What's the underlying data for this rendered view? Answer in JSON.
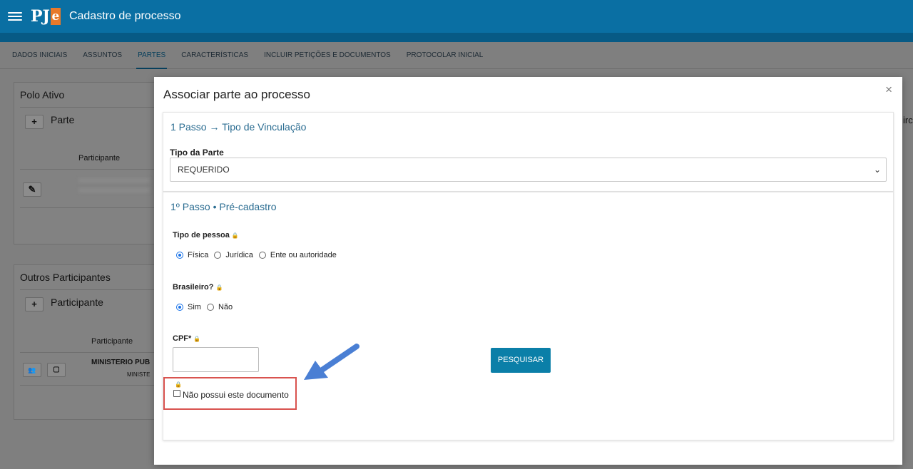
{
  "header": {
    "title": "Cadastro de processo",
    "logo_main": "PJ",
    "logo_accent": "e"
  },
  "tabs": [
    {
      "label": "DADOS INICIAIS"
    },
    {
      "label": "ASSUNTOS"
    },
    {
      "label": "PARTES",
      "active": true
    },
    {
      "label": "CARACTERÍSTICAS"
    },
    {
      "label": "INCLUIR PETIÇÕES E DOCUMENTOS"
    },
    {
      "label": "PROTOCOLAR INICIAL"
    }
  ],
  "background": {
    "polo_ativo": {
      "title": "Polo Ativo",
      "add_label": "Parte",
      "col_participante": "Participante"
    },
    "outros": {
      "title": "Outros Participantes",
      "add_label": "Participante",
      "col_participante": "Participante",
      "row_name": "MINISTERIO PUB",
      "row_sub": "MINISTE"
    },
    "right_edge_text": "irc"
  },
  "modal": {
    "title": "Associar parte ao processo",
    "close": "×",
    "step1": {
      "title": "1 Passo → Tipo de Vinculação",
      "field_label": "Tipo da Parte",
      "select_value": "REQUERIDO"
    },
    "step2": {
      "title": "1º Passo • Pré-cadastro",
      "tipo_pessoa_label": "Tipo de pessoa",
      "tipo_pessoa_options": [
        "Física",
        "Jurídica",
        "Ente ou autoridade"
      ],
      "tipo_pessoa_selected": "Física",
      "brasileiro_label": "Brasileiro?",
      "brasileiro_options": [
        "Sim",
        "Não"
      ],
      "brasileiro_selected": "Sim",
      "cpf_label": "CPF*",
      "cpf_value": "",
      "search_button": "PESQUISAR",
      "no_document_label": "Não possui este documento",
      "no_document_checked": false
    }
  },
  "colors": {
    "primary": "#0a6fa3",
    "accent": "#e8792a",
    "highlight": "#d9534f",
    "arrow": "#4a7fd4"
  }
}
